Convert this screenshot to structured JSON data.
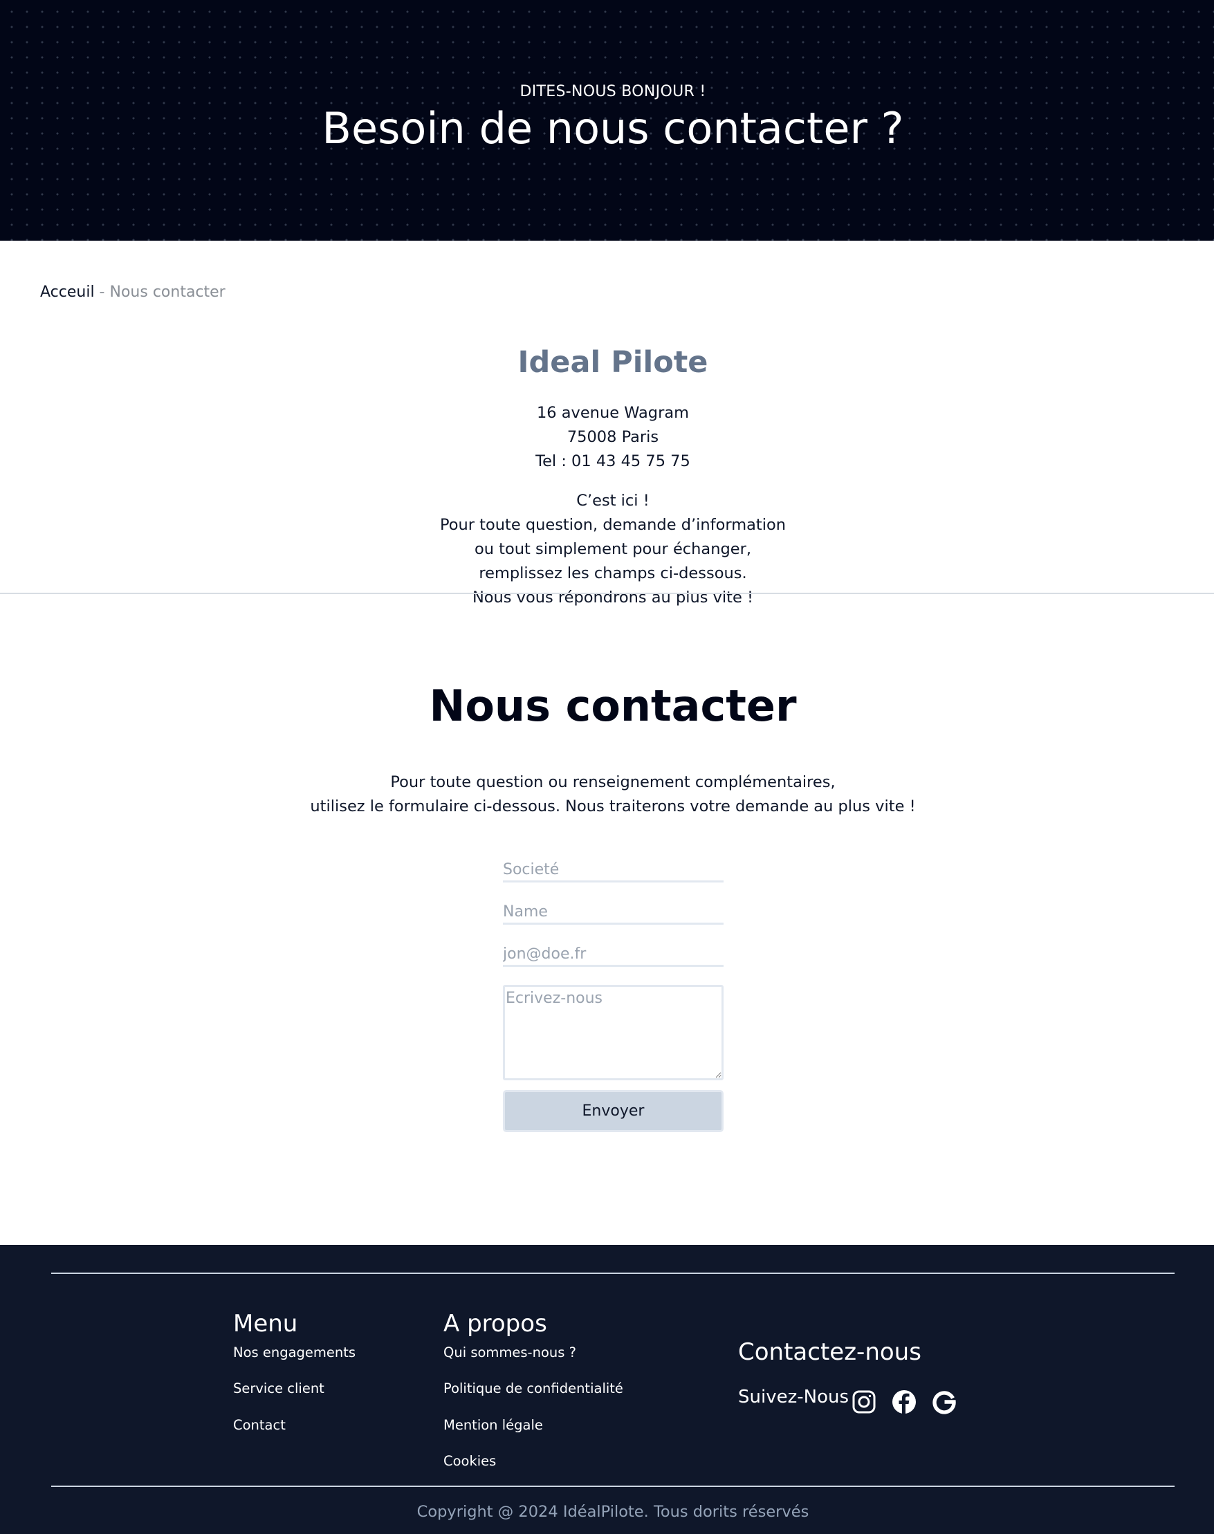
{
  "hero": {
    "eyebrow": "DITES-NOUS BONJOUR !",
    "title": "Besoin de nous contacter ?"
  },
  "breadcrumb": {
    "home": "Acceuil",
    "separator": " - ",
    "current": "Nous contacter"
  },
  "company": {
    "name": "Ideal Pilote",
    "address_lines": [
      "16 avenue Wagram",
      "75008 Paris",
      "Tel : 01 43 45 75 75"
    ],
    "message_lines": [
      "C’est ici !",
      "Pour toute question, demande d’information",
      "ou tout simplement pour échanger,",
      "remplissez les champs ci-dessous.",
      "Nous vous répondrons au plus vite !"
    ]
  },
  "contact": {
    "title": "Nous contacter",
    "intro_lines": [
      "Pour toute question ou renseignement complémentaires,",
      "utilisez le formulaire ci-dessous. Nous traiterons votre demande au plus vite !"
    ],
    "form": {
      "company_placeholder": "Societé",
      "company_value": "",
      "name_placeholder": "Name",
      "name_value": "",
      "email_placeholder": "jon@doe.fr",
      "email_value": "",
      "message_placeholder": "Ecrivez-nous",
      "message_value": "",
      "submit_label": "Envoyer"
    }
  },
  "footer": {
    "menu": {
      "heading": "Menu",
      "links": [
        "Nos engagements",
        "Service client",
        "Contact"
      ]
    },
    "about": {
      "heading": "A propos",
      "links": [
        "Qui sommes-nous ?",
        "Politique de confidentialité",
        "Mention légale",
        "Cookies"
      ]
    },
    "contact": {
      "heading": "Contactez-nous",
      "follow_label": "Suivez-Nous",
      "social_icons": [
        "instagram-icon",
        "facebook-icon",
        "google-icon"
      ]
    },
    "copyright": "Copyright @ 2024 IdéalPilote. Tous dorits réservés"
  },
  "colors": {
    "hero_background": "#020617",
    "footer_background": "#0f172a",
    "company_name": "#64748b",
    "button_background": "#cbd5e1",
    "muted_text": "#94a3b8"
  }
}
